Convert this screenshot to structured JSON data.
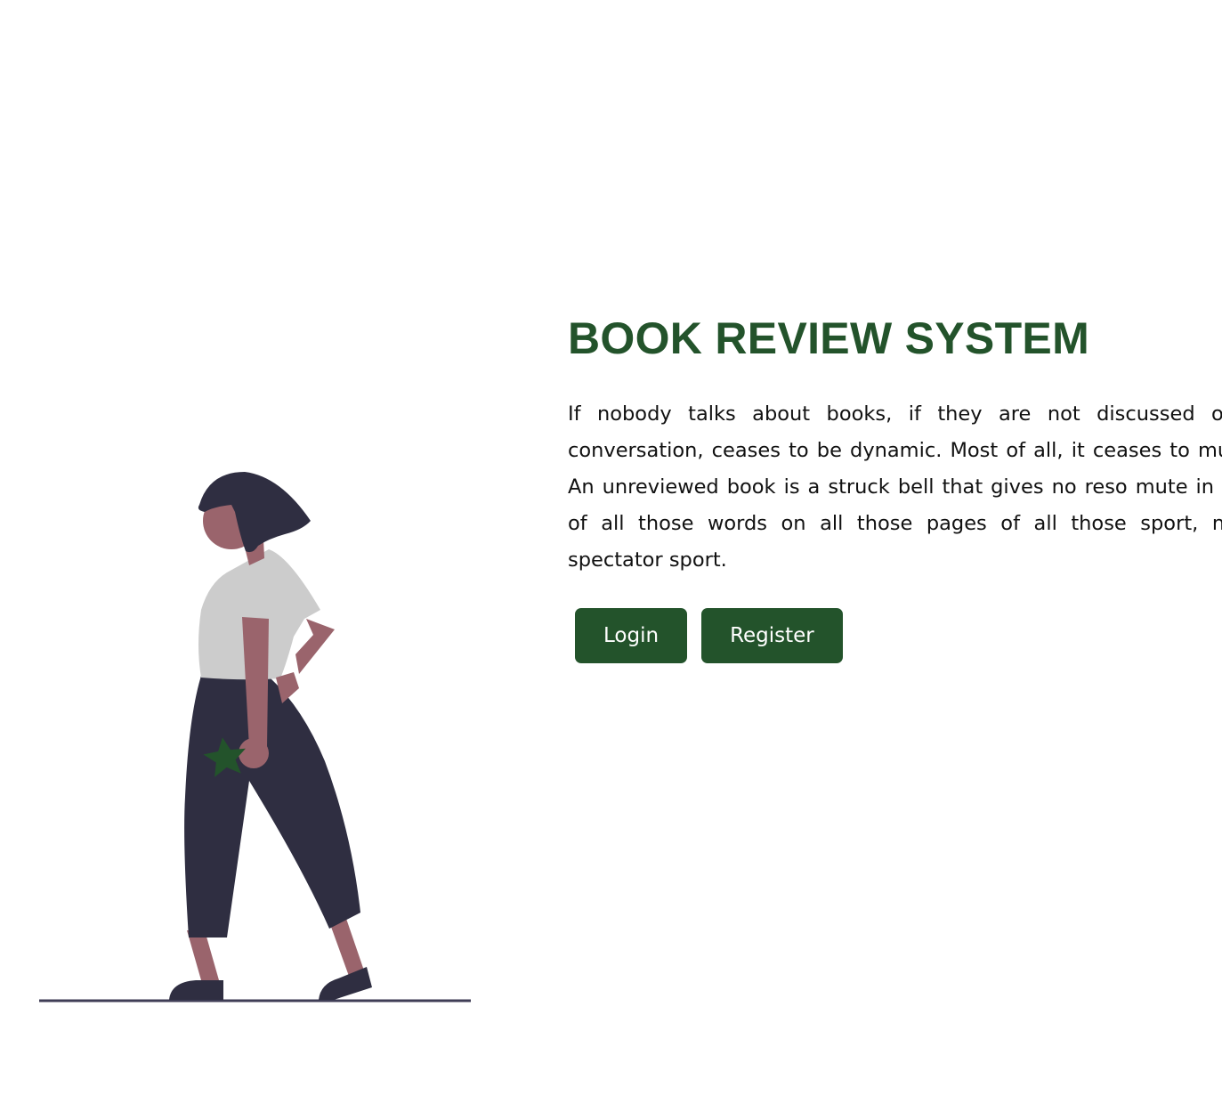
{
  "hero": {
    "title": "BOOK REVIEW SYSTEM",
    "description": "If nobody talks about books, if they are not discussed or so conversation, ceases to be dynamic. Most of all, it ceases to mutter. An unreviewed book is a struck bell that gives no reso mute in spite of all those words on all those pages of all those sport, not a spectator sport."
  },
  "buttons": {
    "login_label": "Login",
    "register_label": "Register"
  },
  "colors": {
    "accent": "#23532b",
    "figure_dark": "#2f2e41",
    "skin": "#9a646c",
    "shirt": "#cccccc"
  }
}
